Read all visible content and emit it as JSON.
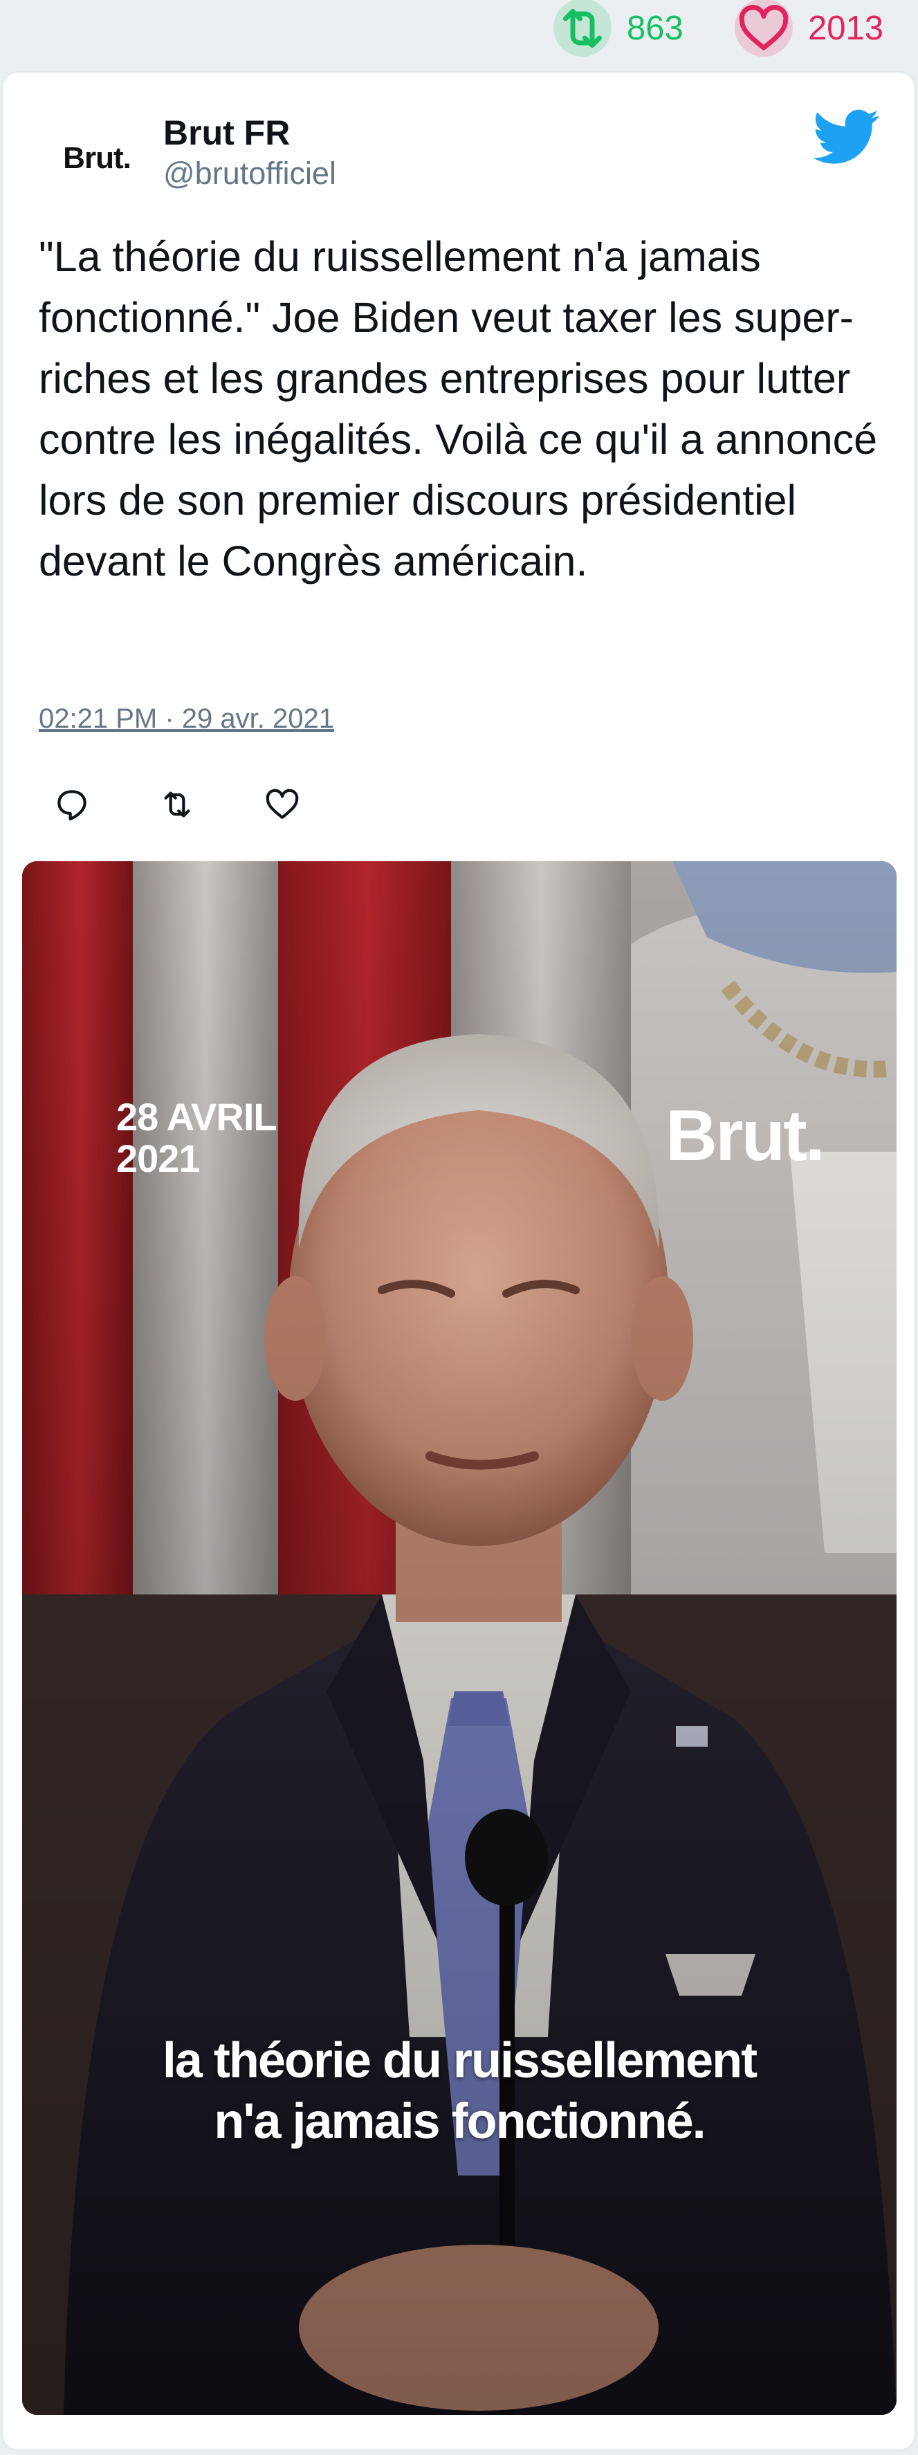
{
  "stats": {
    "retweets": "863",
    "likes": "2013"
  },
  "author": {
    "avatar_text": "Brut.",
    "name": "Brut FR",
    "handle": "@brutofficiel"
  },
  "tweet": {
    "text": "\"La théorie du ruissellement n'a jamais fonctionné.\" Joe Biden veut taxer les super-riches et les grandes entreprises pour lutter contre les inégalités. Voilà ce qu'il a annoncé lors de son premier discours présidentiel devant le Congrès américain.",
    "timestamp": "02:21 PM · 29 avr. 2021"
  },
  "media": {
    "date_line1": "28 AVRIL",
    "date_line2": "2021",
    "brand": "Brut.",
    "caption_line1": "la théorie du ruissellement",
    "caption_line2": "n'a jamais fonctionné."
  },
  "icons": {
    "retweet": "retweet-icon",
    "like": "heart-icon",
    "reply": "reply-icon",
    "bird": "twitter-bird-icon"
  },
  "colors": {
    "retweet": "#17bf63",
    "like": "#e0245e",
    "twitter_blue": "#1da1f2",
    "muted": "#657786"
  }
}
